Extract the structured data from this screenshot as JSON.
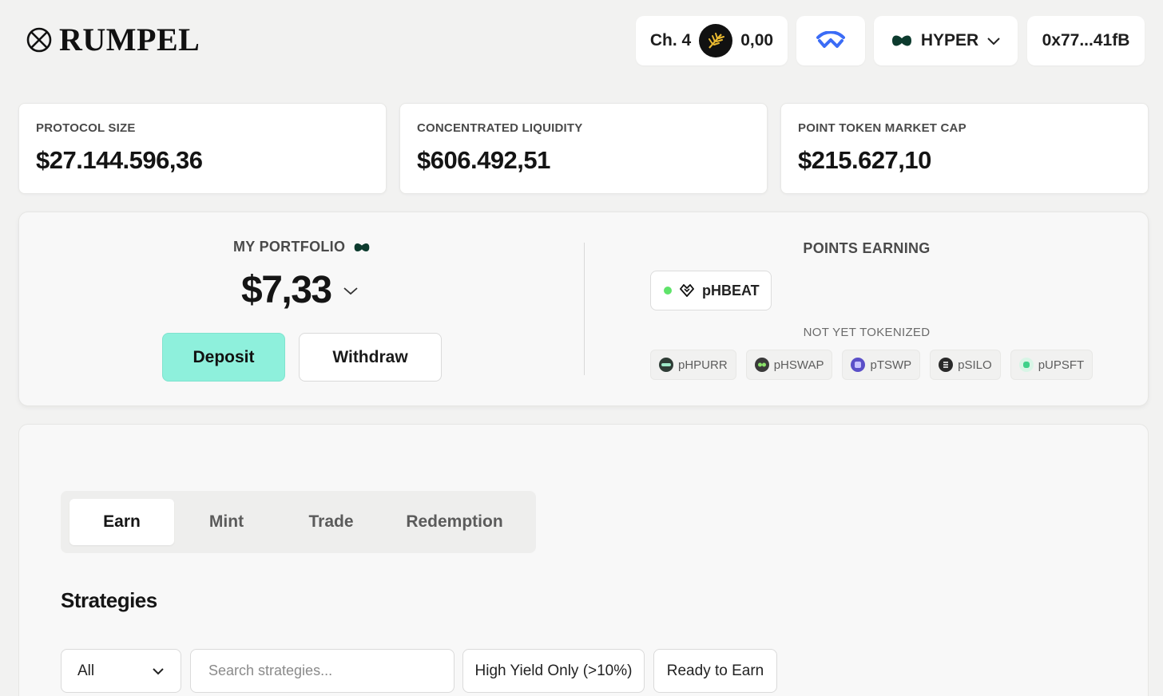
{
  "header": {
    "logo_text": "RUMPEL",
    "chapter_label": "Ch. 4",
    "chapter_points": "0,00",
    "network_label": "HYPER",
    "address": "0x77...41fB"
  },
  "stats": [
    {
      "label": "PROTOCOL SIZE",
      "value": "$27.144.596,36"
    },
    {
      "label": "CONCENTRATED LIQUIDITY",
      "value": "$606.492,51"
    },
    {
      "label": "POINT TOKEN MARKET CAP",
      "value": "$215.627,10"
    }
  ],
  "portfolio": {
    "label": "MY PORTFOLIO",
    "value": "$7,33",
    "deposit_label": "Deposit",
    "withdraw_label": "Withdraw"
  },
  "points": {
    "label": "POINTS EARNING",
    "active_token": "pHBEAT",
    "not_tokenized_label": "NOT YET TOKENIZED",
    "tokens": [
      "pHPURR",
      "pHSWAP",
      "pTSWP",
      "pSILO",
      "pUPSFT"
    ]
  },
  "tabs": [
    "Earn",
    "Mint",
    "Trade",
    "Redemption"
  ],
  "strategies": {
    "title": "Strategies",
    "filter_selected": "All",
    "search_placeholder": "Search strategies...",
    "high_yield_label": "High Yield Only (>10%)",
    "ready_label": "Ready to Earn"
  },
  "colors": {
    "accent": "#8ef0dc",
    "status_dot": "#5fe36a",
    "wallet_blue": "#3b6cf6"
  }
}
